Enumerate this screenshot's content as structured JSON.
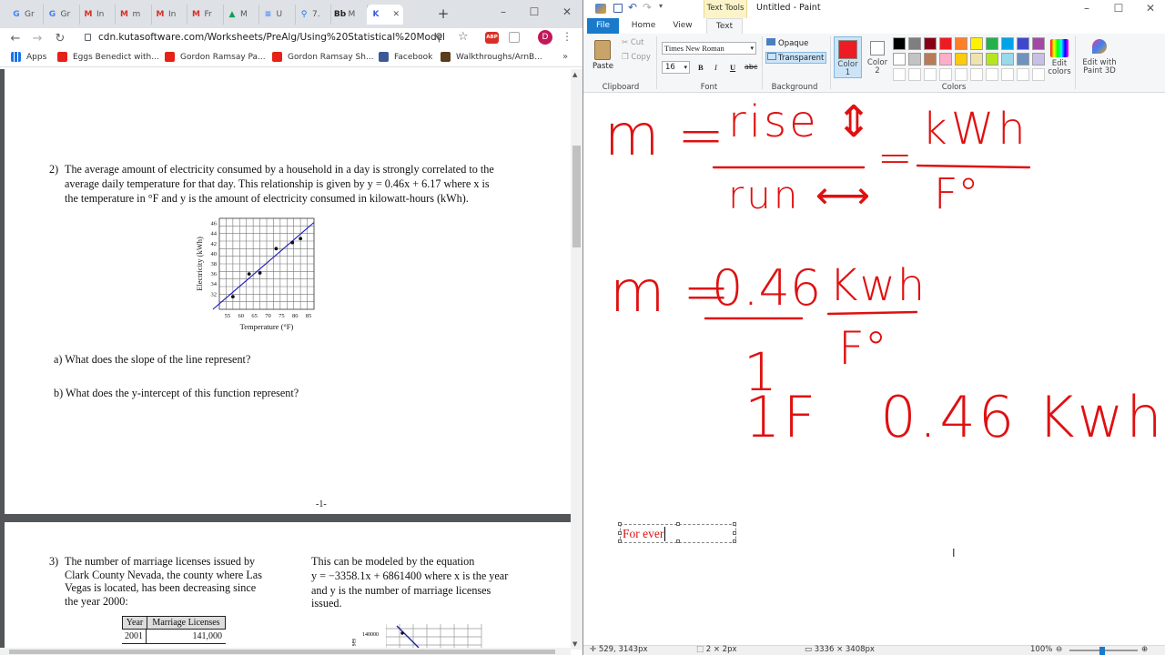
{
  "browser": {
    "tabs": [
      {
        "label": "Gr",
        "icon": "google-icon",
        "color": "#4285f4",
        "glyph": "G"
      },
      {
        "label": "Gr",
        "icon": "google-icon",
        "color": "#4285f4",
        "glyph": "G"
      },
      {
        "label": "In",
        "icon": "gmail-icon",
        "color": "#d93025",
        "glyph": "M"
      },
      {
        "label": "m",
        "icon": "gmail-icon",
        "color": "#d93025",
        "glyph": "M"
      },
      {
        "label": "In",
        "icon": "gmail-icon",
        "color": "#d93025",
        "glyph": "M"
      },
      {
        "label": "Fr",
        "icon": "gmail-icon",
        "color": "#d93025",
        "glyph": "M"
      },
      {
        "label": "M",
        "icon": "drive-icon",
        "color": "#0f9d58",
        "glyph": "▲"
      },
      {
        "label": "U",
        "icon": "docs-icon",
        "color": "#4285f4",
        "glyph": "≡"
      },
      {
        "label": "7.",
        "icon": "maps-icon",
        "color": "#1a73e8",
        "glyph": "⚲"
      },
      {
        "label": "M",
        "icon": "blackboard-icon",
        "color": "#222222",
        "glyph": "Bb"
      },
      {
        "label": "",
        "icon": "kuta-icon",
        "color": "#3b5bdb",
        "glyph": "K"
      }
    ],
    "url": "cdn.kutasoftware.com/Worksheets/PreAlg/Using%20Statistical%20Models....",
    "profile_initial": "D",
    "adblock_label": "ABP",
    "bookmarks": [
      "Apps",
      "Eggs Benedict with...",
      "Gordon Ramsay Pa...",
      "Gordon Ramsay Sh...",
      "Facebook",
      "Walkthroughs/ArnB..."
    ]
  },
  "worksheet": {
    "q2": {
      "number": "2)",
      "line1": "The average amount of electricity consumed by a household in a day is strongly correlated to the",
      "line2": "average daily temperature for that day.  This relationship is given by y = 0.46x + 6.17 where x is",
      "line3": "the temperature in °F and y is the amount of electricity consumed in kilowatt-hours (kWh).",
      "part_a": "a) What does the slope of the line represent?",
      "part_b": "b) What does the y-intercept of this function represent?"
    },
    "page_number": "-1-",
    "q3": {
      "number": "3)",
      "left_lines": [
        "The number of marriage licenses issued by",
        "Clark County Nevada, the county where Las",
        "Vegas is located, has been decreasing since",
        "the year 2000:"
      ],
      "right_lines": [
        "This can be modeled by the equation",
        "y = −3358.1x + 6861400 where x is the year",
        "and y is the number of marriage licenses",
        "issued."
      ],
      "table_headers": [
        "Year",
        "Marriage Licenses"
      ],
      "table_rows": [
        [
          "2001",
          "141,000"
        ]
      ],
      "mini_chart_ytick": "140000",
      "mini_chart_ylabel": "ses"
    }
  },
  "chart_data": {
    "type": "scatter",
    "title": "",
    "xlabel": "Temperature (°F)",
    "ylabel": "Electricity (kWh)",
    "xlim": [
      52,
      87
    ],
    "ylim": [
      29,
      47
    ],
    "x_ticks": [
      55,
      60,
      65,
      70,
      75,
      80,
      85
    ],
    "y_ticks": [
      32,
      34,
      36,
      38,
      40,
      42,
      44,
      46
    ],
    "grid": true,
    "points": [
      [
        57,
        31.5
      ],
      [
        63,
        36
      ],
      [
        67,
        36.2
      ],
      [
        73,
        41
      ],
      [
        79,
        42.2
      ],
      [
        82,
        43
      ]
    ],
    "trend_line": {
      "slope": 0.46,
      "intercept": 6.17
    }
  },
  "paint": {
    "title": "Untitled - Paint",
    "text_tools_label": "Text Tools",
    "tabs": [
      "File",
      "Home",
      "View",
      "Text"
    ],
    "clipboard": {
      "paste": "Paste",
      "cut": "Cut",
      "copy": "Copy",
      "group": "Clipboard"
    },
    "font": {
      "family": "Times New Roman",
      "size": "16",
      "group": "Font",
      "bold": "B",
      "italic": "I",
      "underline": "U",
      "strike": "abc"
    },
    "background": {
      "opaque": "Opaque",
      "transparent": "Transparent",
      "group": "Background"
    },
    "colors": {
      "color1": "Color 1",
      "color2": "Color 2",
      "edit": "Edit colors",
      "group": "Colors",
      "color1_value": "#ed1c24",
      "color2_value": "#ffffff",
      "palette_row1": [
        "#000000",
        "#7f7f7f",
        "#880015",
        "#ed1c24",
        "#ff7f27",
        "#fff200",
        "#22b14c",
        "#00a2e8",
        "#3f48cc",
        "#a349a4"
      ],
      "palette_row2": [
        "#ffffff",
        "#c3c3c3",
        "#b97a57",
        "#ffaec9",
        "#ffc90e",
        "#efe4b0",
        "#b5e61d",
        "#99d9ea",
        "#7092be",
        "#c8bfe7"
      ]
    },
    "paint3d": "Edit with Paint 3D",
    "ink_color": "#e01010",
    "handwriting": {
      "line1_left": "m =",
      "rise": "rise ⇕",
      "run": "run ⟷",
      "eq": "=",
      "kwh1": "kWh",
      "f1": "F°",
      "line2_left": "m =",
      "val": "0.46",
      "kwh2": "Kwh",
      "one": "1",
      "f2": "F°",
      "line3": "1F   0.46 Kwh"
    },
    "text_box_value": "For ever",
    "status": {
      "cursor": "529, 3143px",
      "selection": "2 × 2px",
      "size": "3336 × 3408px",
      "zoom": "100%"
    }
  }
}
